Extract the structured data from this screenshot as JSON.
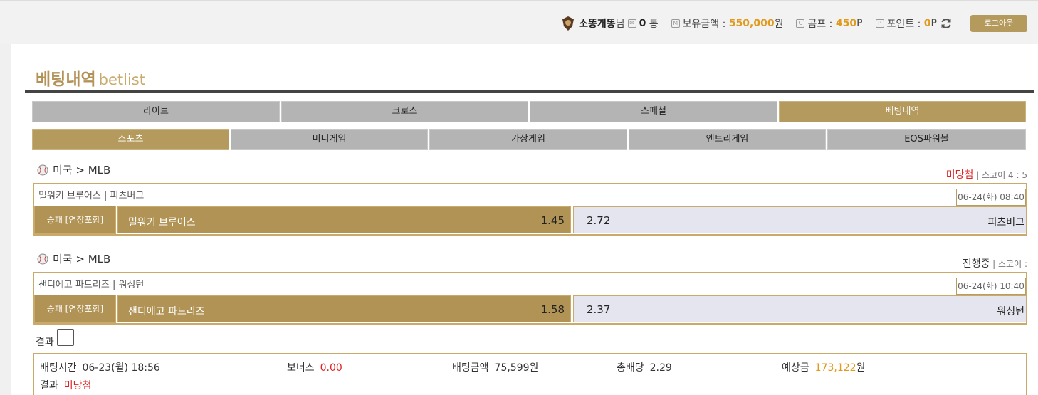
{
  "user": {
    "nickname": "소똥개똥",
    "suffix": "님",
    "messages_count": "0",
    "messages_unit": "통",
    "balance_label": "보유금액 :",
    "balance_value": "550,000",
    "balance_unit": "원",
    "comp_label": "콤프 :",
    "comp_value": "450",
    "comp_unit": "P",
    "point_label": "포인트 :",
    "point_value": "0",
    "point_unit": "P",
    "logout_label": "로그아웃"
  },
  "page": {
    "title": "베팅내역",
    "title_en": "betlist"
  },
  "main_tabs": [
    {
      "label": "라이브",
      "active": false
    },
    {
      "label": "크로스",
      "active": false
    },
    {
      "label": "스페셜",
      "active": false
    },
    {
      "label": "베팅내역",
      "active": true
    }
  ],
  "sub_tabs": [
    {
      "label": "스포츠",
      "active": true
    },
    {
      "label": "미니게임",
      "active": false
    },
    {
      "label": "가상게임",
      "active": false
    },
    {
      "label": "엔트리게임",
      "active": false
    },
    {
      "label": "EOS파워볼",
      "active": false
    }
  ],
  "bets": [
    {
      "league": "미국 > MLB",
      "status": "미당첨",
      "score": "| 스코어 4 : 5",
      "match": "밀워키 브루어스 | 피츠버그",
      "datetime": "06-24(화) 08:40",
      "market": "승패 [연장포함]",
      "home_team": "밀워키 브루어스",
      "home_odds": "1.45",
      "away_odds": "2.72",
      "away_team": "피츠버그"
    },
    {
      "league": "미국 > MLB",
      "status": "진행중",
      "score": "| 스코어 :",
      "match": "샌디에고 파드리즈 | 워싱턴",
      "datetime": "06-24(화) 10:40",
      "market": "승패 [연장포함]",
      "home_team": "샌디에고 파드리즈",
      "home_odds": "1.58",
      "away_odds": "2.37",
      "away_team": "워싱턴"
    }
  ],
  "result_label": "결과",
  "summary": {
    "bet_time_label": "배팅시간",
    "bet_time": "06-23(월) 18:56",
    "bonus_label": "보너스",
    "bonus": "0.00",
    "bet_amount_label": "배팅금액",
    "bet_amount": "75,599원",
    "total_odds_label": "총배당",
    "total_odds": "2.29",
    "expected_label": "예상금",
    "expected_value": "173,122",
    "expected_unit": "원",
    "result_label": "결과",
    "result": "미당첨"
  },
  "colors": {
    "accent_gold": "#b09355",
    "tab_gray": "#b4b4b4",
    "lost_red": "#dd2222",
    "highlight_orange": "#e09a1c"
  }
}
